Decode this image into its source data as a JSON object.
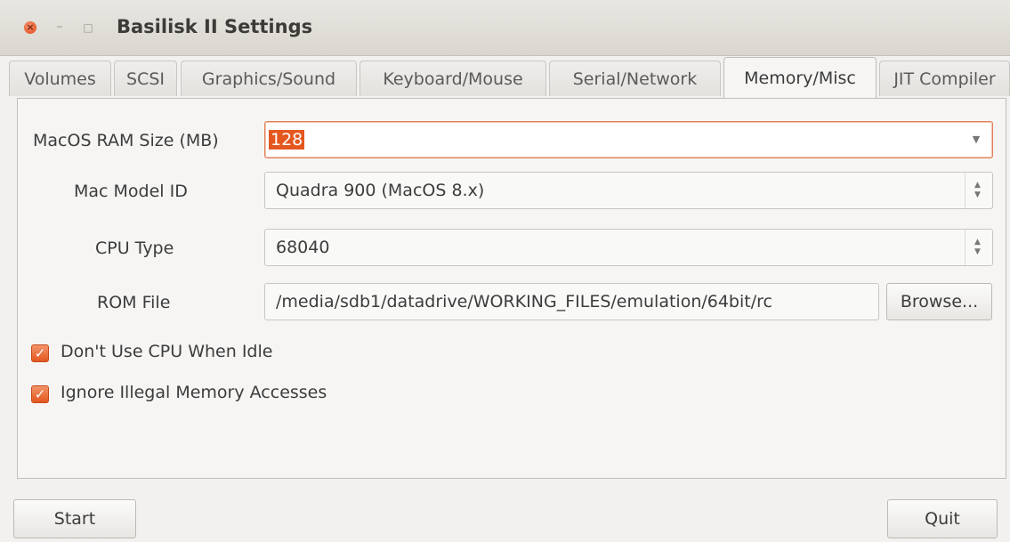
{
  "window": {
    "title": "Basilisk II Settings",
    "controls": {
      "close": "×",
      "minimize": "–",
      "maximize": "□"
    }
  },
  "tabs": [
    {
      "label": "Volumes"
    },
    {
      "label": "SCSI"
    },
    {
      "label": "Graphics/Sound"
    },
    {
      "label": "Keyboard/Mouse"
    },
    {
      "label": "Serial/Network"
    },
    {
      "label": "Memory/Misc",
      "active": true
    },
    {
      "label": "JIT Compiler"
    }
  ],
  "memory": {
    "ram_label": "MacOS RAM Size (MB)",
    "ram_value": "128",
    "model_label": "Mac Model ID",
    "model_value": "Quadra 900 (MacOS 8.x)",
    "cpu_label": "CPU Type",
    "cpu_value": "68040",
    "rom_label": "ROM File",
    "rom_value": "/media/sdb1/datadrive/WORKING_FILES/emulation/64bit/rc",
    "browse_label": "Browse...",
    "idle_label": "Don't Use CPU When Idle",
    "idle_checked": true,
    "illegal_label": "Ignore Illegal Memory Accesses",
    "illegal_checked": true
  },
  "footer": {
    "start_label": "Start",
    "quit_label": "Quit"
  },
  "icons": {
    "dropdown": "chevron-down-icon",
    "spinner": "spinner-icon",
    "check": "checkmark-icon"
  },
  "colors": {
    "accent": "#e4571f",
    "close_button": "#df4a17"
  }
}
